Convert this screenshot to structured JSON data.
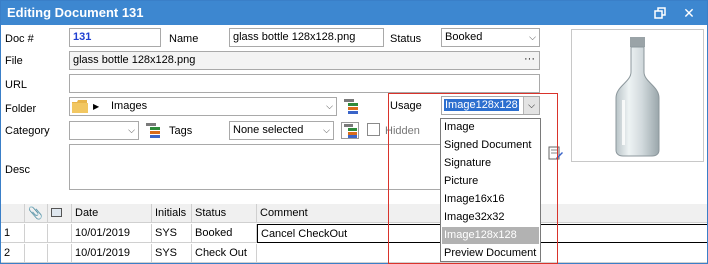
{
  "window": {
    "title": "Editing Document 131",
    "restore_icon": "restore-window-icon",
    "close_icon": "close-icon"
  },
  "form": {
    "doc_no_label": "Doc #",
    "doc_no_value": "131",
    "name_label": "Name",
    "name_value": "glass bottle 128x128.png",
    "status_label": "Status",
    "status_value": "Booked",
    "file_label": "File",
    "file_value": "glass bottle 128x128.png",
    "file_button": "···",
    "url_label": "URL",
    "url_value": "",
    "folder_label": "Folder",
    "folder_value": "Images",
    "usage_label": "Usage",
    "usage_value": "Image128x128",
    "category_label": "Category",
    "category_value": "",
    "tags_label": "Tags",
    "tags_value": "None selected",
    "hidden_label": "Hidden",
    "hidden_checked": false,
    "desc_label": "Desc",
    "desc_value": ""
  },
  "usage_options": [
    "Image",
    "Signed Document",
    "Signature",
    "Picture",
    "Image16x16",
    "Image32x32",
    "Image128x128",
    "Preview Document"
  ],
  "usage_selected_index": 6,
  "grid": {
    "headers": [
      "",
      "",
      "",
      "Date",
      "Initials",
      "Status",
      "Comment"
    ],
    "rows": [
      {
        "num": "1",
        "date": "10/01/2019",
        "initials": "SYS",
        "status": "Booked",
        "comment": "Cancel CheckOut"
      },
      {
        "num": "2",
        "date": "10/01/2019",
        "initials": "SYS",
        "status": "Check Out",
        "comment": ""
      }
    ]
  },
  "colors": {
    "titlebar": "#3d87d0",
    "doc_no": "#1f3fd1",
    "highlight_border": "#d9332b",
    "selected_option": "#b2b2b2"
  }
}
